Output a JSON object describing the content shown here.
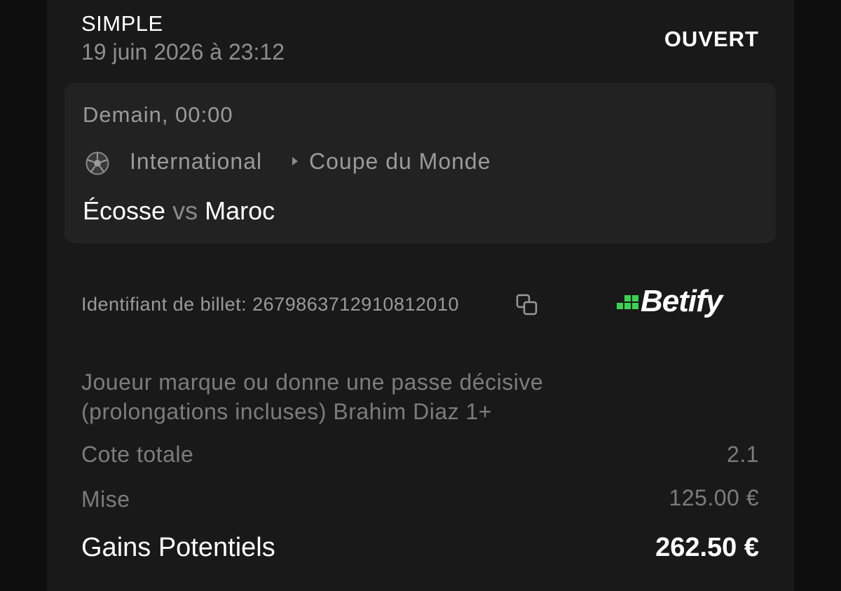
{
  "bet": {
    "type": "SIMPLE",
    "date": "19 juin 2026 à 23:12",
    "status": "OUVERT"
  },
  "event": {
    "time": "Demain, 00:00",
    "sport_icon": "soccer-ball-icon",
    "league": "International",
    "competition": "Coupe du Monde",
    "home_team": "Écosse",
    "vs": "vs",
    "away_team": "Maroc"
  },
  "ticket": {
    "label": "Identifiant de billet: 2679863712910812010",
    "copy_icon": "copy-icon"
  },
  "brand": {
    "name": "Betify",
    "accent_color": "#39d353"
  },
  "selection": {
    "line1": "Joueur marque ou donne une passe décisive",
    "line2": "(prolongations incluses) Brahim Diaz 1+"
  },
  "summary": {
    "odds_label": "Cote totale",
    "odds_value": "2.1",
    "stake_label": "Mise",
    "stake_value": "125.00 €",
    "winnings_label": "Gains Potentiels",
    "winnings_value": "262.50 €"
  }
}
